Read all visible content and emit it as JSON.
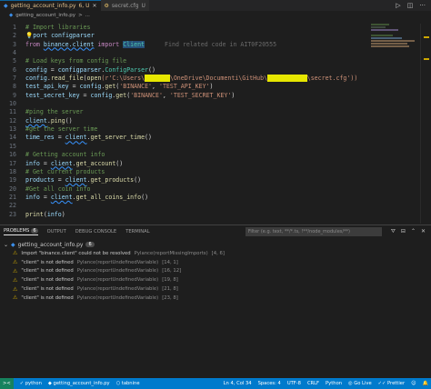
{
  "tabs": [
    {
      "name": "getting_account_info.py",
      "status": "6, U",
      "active": true
    },
    {
      "name": "secret.cfg",
      "status": "U",
      "active": false
    }
  ],
  "breadcrumb": {
    "file": "getting_account_info.py",
    "sep": ">",
    "more": "..."
  },
  "editor": {
    "line_numbers": [
      "1",
      "2",
      "3",
      "4",
      "5",
      "6",
      "7",
      "8",
      "9",
      "10",
      "11",
      "12",
      "13",
      "14",
      "15",
      "16",
      "17",
      "18",
      "19",
      "20",
      "21",
      "22",
      "23"
    ],
    "ghost_hint": "Find related code in AIT0F20555",
    "lines": {
      "l1": "# Import libraries",
      "l2a": "port configparser",
      "l3a": "from ",
      "l3b": "binance.client",
      "l3c": " import ",
      "l3d": "Client",
      "l5": "# Load keys from config file",
      "l6a": "config",
      "l6b": " = ",
      "l6c": "configparser",
      "l6d": ".",
      "l6e": "ConfigParser",
      "l6f": "()",
      "l7a": "config",
      "l7b": ".",
      "l7c": "read_file",
      "l7d": "(",
      "l7e": "open",
      "l7f": "(r'C:\\Users\\",
      "l7g": "xxxxxxx",
      "l7h": "\\OneDrive\\Documenti\\GitHub\\",
      "l7i": "xxxxxxxxxxx",
      "l7j": "\\secret.cfg'))",
      "l8a": "test_api_key",
      "l8b": " = ",
      "l8c": "config",
      "l8d": ".",
      "l8e": "get",
      "l8f": "(",
      "l8g": "'BINANCE'",
      "l8h": ", ",
      "l8i": "'TEST_API_KEY'",
      "l8j": ")",
      "l9a": "test_secret_key",
      "l9b": " = ",
      "l9c": "config",
      "l9d": ".",
      "l9e": "get",
      "l9f": "(",
      "l9g": "'BINANCE'",
      "l9h": ", ",
      "l9i": "'TEST_SECRET_KEY'",
      "l9j": ")",
      "l11": "#ping the server",
      "l12a": "client",
      "l12b": ".",
      "l12c": "ping",
      "l12d": "()",
      "l13": "#get the server time",
      "l14a": "time_res",
      "l14b": " = ",
      "l14c": "client",
      "l14d": ".",
      "l14e": "get_server_time",
      "l14f": "()",
      "l16": "# Getting account info",
      "l17a": "info",
      "l17b": " = ",
      "l17c": "client",
      "l17d": ".",
      "l17e": "get_account",
      "l17f": "()",
      "l18": "# Get current products",
      "l19a": "products",
      "l19b": " = ",
      "l19c": "client",
      "l19d": ".",
      "l19e": "get_products",
      "l19f": "()",
      "l20": "#Get all coin info",
      "l21a": "info",
      "l21b": " = ",
      "l21c": "client",
      "l21d": ".",
      "l21e": "get_all_coins_info",
      "l21f": "()",
      "l23a": "print",
      "l23b": "(",
      "l23c": "info",
      "l23d": ")"
    }
  },
  "panel": {
    "tabs": [
      {
        "label": "PROBLEMS",
        "count": "6"
      },
      {
        "label": "OUTPUT"
      },
      {
        "label": "DEBUG CONSOLE"
      },
      {
        "label": "TERMINAL"
      }
    ],
    "filter_placeholder": "Filter (e.g. text, **/*.ts, !**/node_modules/**)",
    "file": {
      "name": "getting_account_info.py",
      "count": "6"
    },
    "problems": [
      {
        "msg": "Import \"binance.client\" could not be resolved",
        "src": "Pylance(reportMissingImports)",
        "pos": "[4, 6]"
      },
      {
        "msg": "\"client\" is not defined",
        "src": "Pylance(reportUndefinedVariable)",
        "pos": "[14, 1]"
      },
      {
        "msg": "\"client\" is not defined",
        "src": "Pylance(reportUndefinedVariable)",
        "pos": "[16, 12]"
      },
      {
        "msg": "\"client\" is not defined",
        "src": "Pylance(reportUndefinedVariable)",
        "pos": "[19, 8]"
      },
      {
        "msg": "\"client\" is not defined",
        "src": "Pylance(reportUndefinedVariable)",
        "pos": "[21, 8]"
      },
      {
        "msg": "\"client\" is not defined",
        "src": "Pylance(reportUndefinedVariable)",
        "pos": "[23, 8]"
      }
    ]
  },
  "statusbar": {
    "remote": "><",
    "env": "python",
    "file": "getting_account_info.py",
    "tabnine": "tabnine",
    "position": "Ln 4, Col 34",
    "spaces": "Spaces: 4",
    "encoding": "UTF-8",
    "eol": "CRLF",
    "language": "Python",
    "golive": "Go Live",
    "prettier": "Prettier"
  },
  "colors": {
    "accent": "#007acc",
    "warning": "#cca700",
    "redaction": "#e6e600"
  }
}
